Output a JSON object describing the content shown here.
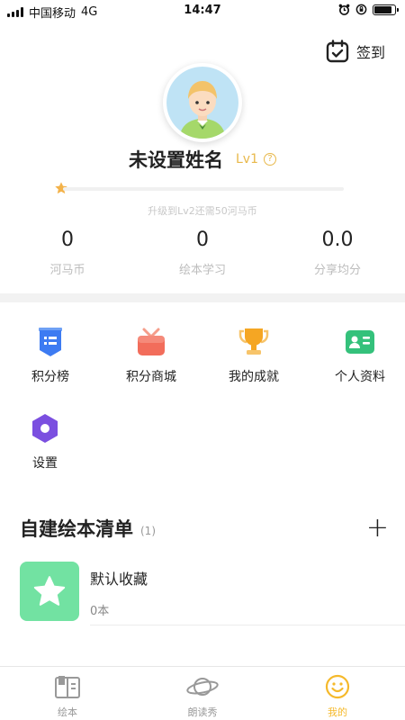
{
  "status_bar": {
    "carrier": "中国移动",
    "network": "4G",
    "time": "14:47"
  },
  "header": {
    "checkin_label": "签到"
  },
  "profile": {
    "name": "未设置姓名",
    "level": "Lv1",
    "level_help": "?",
    "progress_fraction": 0.0,
    "upgrade_tip": "升级到Lv2还需50河马币"
  },
  "stats": [
    {
      "value": "0",
      "label": "河马币"
    },
    {
      "value": "0",
      "label": "绘本学习"
    },
    {
      "value": "0.0",
      "label": "分享均分"
    }
  ],
  "menu": [
    {
      "label": "积分榜",
      "icon": "leaderboard-icon",
      "color": "#3d7bf2"
    },
    {
      "label": "积分商城",
      "icon": "gift-icon",
      "color": "#f26d5b"
    },
    {
      "label": "我的成就",
      "icon": "trophy-icon",
      "color": "#f5a623"
    },
    {
      "label": "个人资料",
      "icon": "profile-card-icon",
      "color": "#34c17b"
    },
    {
      "label": "设置",
      "icon": "settings-icon",
      "color": "#7b4fe0"
    }
  ],
  "section": {
    "title": "自建绘本清单",
    "count": "(1)",
    "add_symbol": "+"
  },
  "book_lists": [
    {
      "title": "默认收藏",
      "count": "0本",
      "cover_color": "#72e2a2"
    }
  ],
  "tabbar": [
    {
      "label": "绘本",
      "icon": "book-icon",
      "active": false
    },
    {
      "label": "朗读秀",
      "icon": "planet-icon",
      "active": false
    },
    {
      "label": "我的",
      "icon": "smiley-icon",
      "active": true
    }
  ],
  "colors": {
    "accent": "#f5b92b",
    "level": "#e8b84a",
    "band": "#f2f2f2"
  }
}
